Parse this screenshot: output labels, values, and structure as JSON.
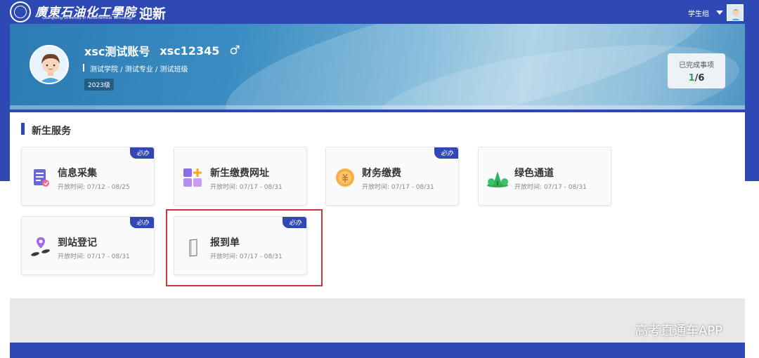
{
  "navbar": {
    "logo_cn": "廣東石油化工學院",
    "logo_en": "Guangdong University of Petrochemical Technology",
    "logo_tag": "迎新",
    "role": "学生组"
  },
  "profile": {
    "name": "xsc测试账号",
    "student_id": "xsc12345",
    "gender_symbol": "♂",
    "path": "测试学院 / 测试专业 / 测试班级",
    "grade": "2023级",
    "progress_label": "已完成事项",
    "progress_done": "1",
    "progress_total": "/6"
  },
  "services": {
    "title": "新生服务",
    "items": [
      {
        "title": "信息采集",
        "time": "开放时间: 07/12 - 08/25",
        "badge": "必办",
        "icon": "form-icon"
      },
      {
        "title": "新生缴费网址",
        "time": "开放时间: 07/17 - 08/31",
        "badge": "",
        "icon": "apps-icon"
      },
      {
        "title": "财务缴费",
        "time": "开放时间: 07/17 - 08/31",
        "badge": "必办",
        "icon": "coin-icon"
      },
      {
        "title": "绿色通道",
        "time": "开放时间: 07/17 - 08/31",
        "badge": "",
        "icon": "tree-icon"
      },
      {
        "title": "到站登记",
        "time": "开放时间: 07/17 - 08/31",
        "badge": "必办",
        "icon": "location-pin-icon"
      },
      {
        "title": "报到单",
        "time": "开放时间: 07/17 - 08/31",
        "badge": "必办",
        "icon": "document-icon"
      }
    ]
  },
  "watermark": "高考直通车APP",
  "colors": {
    "primary": "#2e49b4",
    "highlight": "#c9373b",
    "done": "#2e9e57"
  }
}
